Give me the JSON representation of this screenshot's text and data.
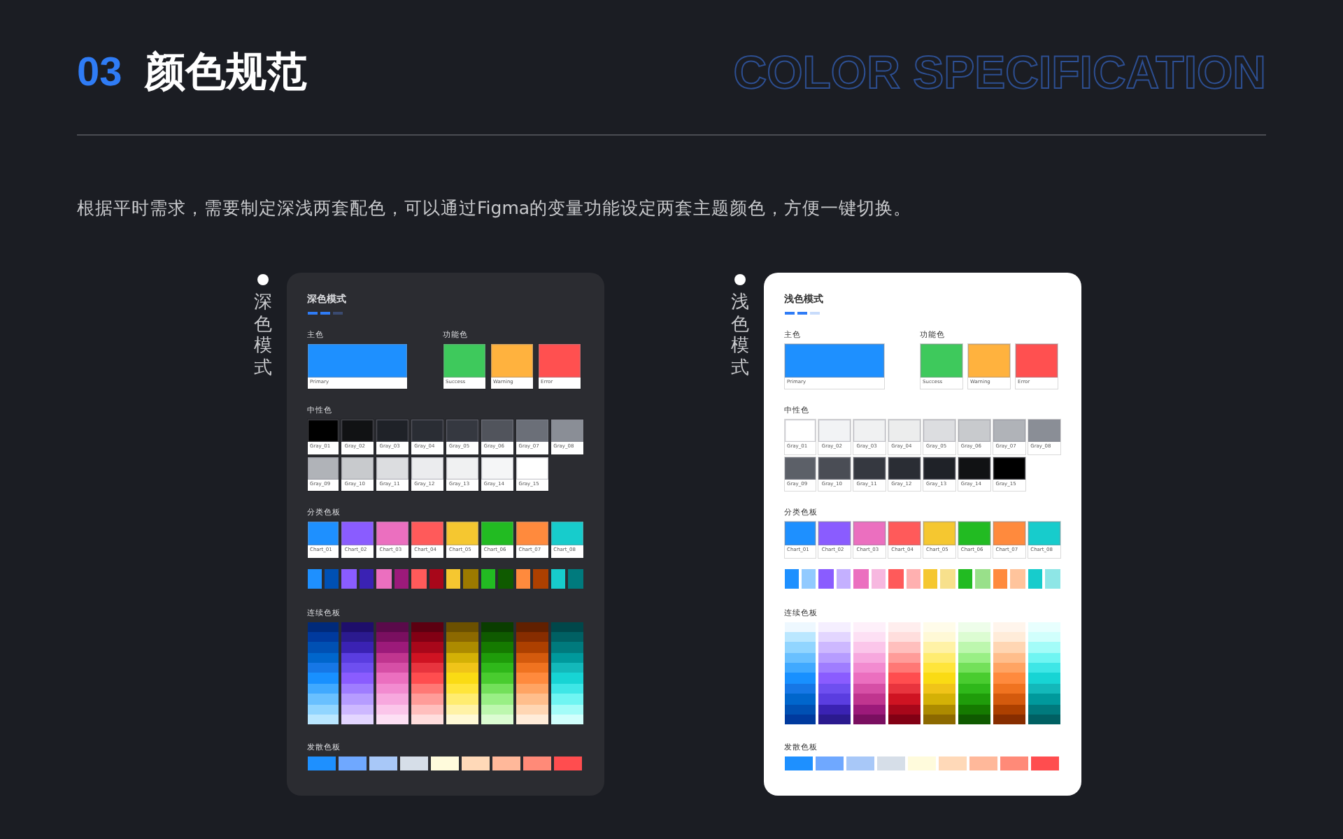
{
  "header": {
    "number": "03",
    "title": "颜色规范",
    "subtitle": "COLOR SPECIFICATION"
  },
  "description": "根据平时需求，需要制定深浅两套配色，可以通过Figma的变量功能设定两套主题颜色，方便一键切换。",
  "panels": [
    {
      "label": "深色模式",
      "kind": "dark",
      "card": {
        "title": "深色模式",
        "primary": {
          "heading": "主色",
          "swatches": [
            {
              "name": "Primary",
              "color": "#1e90ff"
            }
          ]
        },
        "functional": {
          "heading": "功能色",
          "swatches": [
            {
              "name": "Success",
              "color": "#3ec95c"
            },
            {
              "name": "Warning",
              "color": "#ffb23e"
            },
            {
              "name": "Error",
              "color": "#ff5050"
            }
          ]
        },
        "neutral": {
          "heading": "中性色",
          "swatches": [
            {
              "name": "Gray_01",
              "color": "#000000"
            },
            {
              "name": "Gray_02",
              "color": "#111214"
            },
            {
              "name": "Gray_03",
              "color": "#1f2228"
            },
            {
              "name": "Gray_04",
              "color": "#2a2d34"
            },
            {
              "name": "Gray_05",
              "color": "#353840"
            },
            {
              "name": "Gray_06",
              "color": "#51545c"
            },
            {
              "name": "Gray_07",
              "color": "#6b6f78"
            },
            {
              "name": "Gray_08",
              "color": "#8a8e96"
            },
            {
              "name": "Gray_09",
              "color": "#b0b3b8"
            },
            {
              "name": "Gray_10",
              "color": "#c8cacd"
            },
            {
              "name": "Gray_11",
              "color": "#dcdde0"
            },
            {
              "name": "Gray_12",
              "color": "#ebecee"
            },
            {
              "name": "Gray_13",
              "color": "#f0f1f2"
            },
            {
              "name": "Gray_14",
              "color": "#f5f6f7"
            },
            {
              "name": "Gray_15",
              "color": "#ffffff"
            }
          ]
        },
        "categorical": {
          "heading": "分类色板",
          "swatches": [
            {
              "name": "Chart_01",
              "color": "#1e90ff"
            },
            {
              "name": "Chart_02",
              "color": "#8a5cff"
            },
            {
              "name": "Chart_03",
              "color": "#eb6fbf"
            },
            {
              "name": "Chart_04",
              "color": "#ff5a5a"
            },
            {
              "name": "Chart_05",
              "color": "#f5c730"
            },
            {
              "name": "Chart_06",
              "color": "#22bb22"
            },
            {
              "name": "Chart_07",
              "color": "#ff8a3d"
            },
            {
              "name": "Chart_08",
              "color": "#17cccc"
            }
          ],
          "pairs": [
            {
              "color": "#1e90ff"
            },
            {
              "color": "#0050b3"
            },
            {
              "color": "#8a5cff"
            },
            {
              "color": "#3a22b3"
            },
            {
              "color": "#eb6fbf"
            },
            {
              "color": "#9c1a7a"
            },
            {
              "color": "#ff5a5a"
            },
            {
              "color": "#a8071a"
            },
            {
              "color": "#f5c730"
            },
            {
              "color": "#9c7a00"
            },
            {
              "color": "#22bb22"
            },
            {
              "color": "#0f5a00"
            },
            {
              "color": "#ff8a3d"
            },
            {
              "color": "#ad4000"
            },
            {
              "color": "#17cccc"
            },
            {
              "color": "#007a7d"
            }
          ]
        },
        "sequential": {
          "heading": "连续色板",
          "columns": [
            {
              "cells": [
                {
                  "color": "#002a7a"
                },
                {
                  "color": "#003a9e"
                },
                {
                  "color": "#0050b3"
                },
                {
                  "color": "#0066cc"
                },
                {
                  "color": "#1677e6"
                },
                {
                  "color": "#1890ff"
                },
                {
                  "color": "#40a9ff"
                },
                {
                  "color": "#69c0ff"
                },
                {
                  "color": "#91d5ff"
                },
                {
                  "color": "#bae7ff"
                }
              ]
            },
            {
              "cells": [
                {
                  "color": "#1e0e6b"
                },
                {
                  "color": "#2b1a8f"
                },
                {
                  "color": "#3a22b3"
                },
                {
                  "color": "#5a3de0"
                },
                {
                  "color": "#6e4ff0"
                },
                {
                  "color": "#8a5cff"
                },
                {
                  "color": "#9f7dff"
                },
                {
                  "color": "#b69cff"
                },
                {
                  "color": "#cdb8ff"
                },
                {
                  "color": "#e3d6ff"
                }
              ]
            },
            {
              "cells": [
                {
                  "color": "#5a0a4a"
                },
                {
                  "color": "#7a0f60"
                },
                {
                  "color": "#9c1a7a"
                },
                {
                  "color": "#c0358f"
                },
                {
                  "color": "#d64fa6"
                },
                {
                  "color": "#eb6fbf"
                },
                {
                  "color": "#f28bd0"
                },
                {
                  "color": "#f7a8de"
                },
                {
                  "color": "#fbc6ea"
                },
                {
                  "color": "#fde0f4"
                }
              ]
            },
            {
              "cells": [
                {
                  "color": "#5c0011"
                },
                {
                  "color": "#820014"
                },
                {
                  "color": "#a8071a"
                },
                {
                  "color": "#cf1322"
                },
                {
                  "color": "#e8343e"
                },
                {
                  "color": "#ff4d4f"
                },
                {
                  "color": "#ff7875"
                },
                {
                  "color": "#ff9c99"
                },
                {
                  "color": "#ffbfbd"
                },
                {
                  "color": "#ffdedd"
                }
              ]
            },
            {
              "cells": [
                {
                  "color": "#6b5000"
                },
                {
                  "color": "#8c6900"
                },
                {
                  "color": "#ad8b00"
                },
                {
                  "color": "#d4b106"
                },
                {
                  "color": "#f0c419"
                },
                {
                  "color": "#fadb14"
                },
                {
                  "color": "#ffe53b"
                },
                {
                  "color": "#ffec70"
                },
                {
                  "color": "#fff2a6"
                },
                {
                  "color": "#fff9d6"
                }
              ]
            },
            {
              "cells": [
                {
                  "color": "#0a3d00"
                },
                {
                  "color": "#0f5a00"
                },
                {
                  "color": "#157a00"
                },
                {
                  "color": "#1f9c0a"
                },
                {
                  "color": "#2fb81a"
                },
                {
                  "color": "#49cc2f"
                },
                {
                  "color": "#73e05a"
                },
                {
                  "color": "#99ef85"
                },
                {
                  "color": "#bdf7ae"
                },
                {
                  "color": "#dcfcd2"
                }
              ]
            },
            {
              "cells": [
                {
                  "color": "#612000"
                },
                {
                  "color": "#872d00"
                },
                {
                  "color": "#ad4000"
                },
                {
                  "color": "#d45a0d"
                },
                {
                  "color": "#f07320"
                },
                {
                  "color": "#ff8a3d"
                },
                {
                  "color": "#ffa463"
                },
                {
                  "color": "#ffbe8c"
                },
                {
                  "color": "#ffd6b3"
                },
                {
                  "color": "#ffecd9"
                }
              ]
            },
            {
              "cells": [
                {
                  "color": "#00474a"
                },
                {
                  "color": "#006063"
                },
                {
                  "color": "#007a7d"
                },
                {
                  "color": "#00999c"
                },
                {
                  "color": "#13b8ba"
                },
                {
                  "color": "#17d4d4"
                },
                {
                  "color": "#3ee6e6"
                },
                {
                  "color": "#6ff5f2"
                },
                {
                  "color": "#a3fcf8"
                },
                {
                  "color": "#d1fffc"
                }
              ]
            }
          ]
        },
        "diverging": {
          "heading": "发散色板",
          "swatches": [
            {
              "color": "#1e90ff"
            },
            {
              "color": "#6fa8ff"
            },
            {
              "color": "#a8c8f8"
            },
            {
              "color": "#d6dee8"
            },
            {
              "color": "#fffbdc"
            },
            {
              "color": "#ffd9b8"
            },
            {
              "color": "#ffb89a"
            },
            {
              "color": "#ff8a78"
            },
            {
              "color": "#ff4d4f"
            }
          ]
        }
      }
    },
    {
      "label": "浅色模式",
      "kind": "light",
      "card": {
        "title": "浅色模式",
        "primary": {
          "heading": "主色",
          "swatches": [
            {
              "name": "Primary",
              "color": "#1e90ff"
            }
          ]
        },
        "functional": {
          "heading": "功能色",
          "swatches": [
            {
              "name": "Success",
              "color": "#3ec95c"
            },
            {
              "name": "Warning",
              "color": "#ffb23e"
            },
            {
              "name": "Error",
              "color": "#ff5050"
            }
          ]
        },
        "neutral": {
          "heading": "中性色",
          "swatches": [
            {
              "name": "Gray_01",
              "color": "#ffffff"
            },
            {
              "name": "Gray_02",
              "color": "#f2f3f5"
            },
            {
              "name": "Gray_03",
              "color": "#f0f1f2"
            },
            {
              "name": "Gray_04",
              "color": "#eceded"
            },
            {
              "name": "Gray_05",
              "color": "#dcdde0"
            },
            {
              "name": "Gray_06",
              "color": "#c8cacd"
            },
            {
              "name": "Gray_07",
              "color": "#b0b3b8"
            },
            {
              "name": "Gray_08",
              "color": "#8a8e96"
            },
            {
              "name": "Gray_09",
              "color": "#5c6068"
            },
            {
              "name": "Gray_10",
              "color": "#4a4d55"
            },
            {
              "name": "Gray_11",
              "color": "#353840"
            },
            {
              "name": "Gray_12",
              "color": "#2a2d34"
            },
            {
              "name": "Gray_13",
              "color": "#1f2228"
            },
            {
              "name": "Gray_14",
              "color": "#111214"
            },
            {
              "name": "Gray_15",
              "color": "#000000"
            }
          ]
        },
        "categorical": {
          "heading": "分类色板",
          "swatches": [
            {
              "name": "Chart_01",
              "color": "#1e90ff"
            },
            {
              "name": "Chart_02",
              "color": "#8a5cff"
            },
            {
              "name": "Chart_03",
              "color": "#eb6fbf"
            },
            {
              "name": "Chart_04",
              "color": "#ff5a5a"
            },
            {
              "name": "Chart_05",
              "color": "#f5c730"
            },
            {
              "name": "Chart_06",
              "color": "#22bb22"
            },
            {
              "name": "Chart_07",
              "color": "#ff8a3d"
            },
            {
              "name": "Chart_08",
              "color": "#17cccc"
            }
          ],
          "pairs": [
            {
              "color": "#1e90ff"
            },
            {
              "color": "#91caff"
            },
            {
              "color": "#8a5cff"
            },
            {
              "color": "#c4b0ff"
            },
            {
              "color": "#eb6fbf"
            },
            {
              "color": "#f7b8e0"
            },
            {
              "color": "#ff5a5a"
            },
            {
              "color": "#ffb0b0"
            },
            {
              "color": "#f5c730"
            },
            {
              "color": "#f7e08c"
            },
            {
              "color": "#22bb22"
            },
            {
              "color": "#99e08a"
            },
            {
              "color": "#ff8a3d"
            },
            {
              "color": "#ffc49c"
            },
            {
              "color": "#17cccc"
            },
            {
              "color": "#8ee6e6"
            }
          ]
        },
        "sequential": {
          "heading": "连续色板",
          "columns": [
            {
              "cells": [
                {
                  "color": "#eef8ff"
                },
                {
                  "color": "#bae7ff"
                },
                {
                  "color": "#91d5ff"
                },
                {
                  "color": "#69c0ff"
                },
                {
                  "color": "#40a9ff"
                },
                {
                  "color": "#1890ff"
                },
                {
                  "color": "#1677e6"
                },
                {
                  "color": "#0066cc"
                },
                {
                  "color": "#0050b3"
                },
                {
                  "color": "#003a9e"
                }
              ]
            },
            {
              "cells": [
                {
                  "color": "#f5efff"
                },
                {
                  "color": "#e3d6ff"
                },
                {
                  "color": "#cdb8ff"
                },
                {
                  "color": "#b69cff"
                },
                {
                  "color": "#9f7dff"
                },
                {
                  "color": "#8a5cff"
                },
                {
                  "color": "#6e4ff0"
                },
                {
                  "color": "#5a3de0"
                },
                {
                  "color": "#3a22b3"
                },
                {
                  "color": "#2b1a8f"
                }
              ]
            },
            {
              "cells": [
                {
                  "color": "#fef0fa"
                },
                {
                  "color": "#fde0f4"
                },
                {
                  "color": "#fbc6ea"
                },
                {
                  "color": "#f7a8de"
                },
                {
                  "color": "#f28bd0"
                },
                {
                  "color": "#eb6fbf"
                },
                {
                  "color": "#d64fa6"
                },
                {
                  "color": "#c0358f"
                },
                {
                  "color": "#9c1a7a"
                },
                {
                  "color": "#7a0f60"
                }
              ]
            },
            {
              "cells": [
                {
                  "color": "#ffeeee"
                },
                {
                  "color": "#ffdedd"
                },
                {
                  "color": "#ffbfbd"
                },
                {
                  "color": "#ff9c99"
                },
                {
                  "color": "#ff7875"
                },
                {
                  "color": "#ff4d4f"
                },
                {
                  "color": "#e8343e"
                },
                {
                  "color": "#cf1322"
                },
                {
                  "color": "#a8071a"
                },
                {
                  "color": "#820014"
                }
              ]
            },
            {
              "cells": [
                {
                  "color": "#fffcea"
                },
                {
                  "color": "#fff9d6"
                },
                {
                  "color": "#fff2a6"
                },
                {
                  "color": "#ffec70"
                },
                {
                  "color": "#ffe53b"
                },
                {
                  "color": "#fadb14"
                },
                {
                  "color": "#f0c419"
                },
                {
                  "color": "#d4b106"
                },
                {
                  "color": "#ad8b00"
                },
                {
                  "color": "#8c6900"
                }
              ]
            },
            {
              "cells": [
                {
                  "color": "#eefdea"
                },
                {
                  "color": "#dcfcd2"
                },
                {
                  "color": "#bdf7ae"
                },
                {
                  "color": "#99ef85"
                },
                {
                  "color": "#73e05a"
                },
                {
                  "color": "#49cc2f"
                },
                {
                  "color": "#2fb81a"
                },
                {
                  "color": "#1f9c0a"
                },
                {
                  "color": "#157a00"
                },
                {
                  "color": "#0f5a00"
                }
              ]
            },
            {
              "cells": [
                {
                  "color": "#fff5ec"
                },
                {
                  "color": "#ffecd9"
                },
                {
                  "color": "#ffd6b3"
                },
                {
                  "color": "#ffbe8c"
                },
                {
                  "color": "#ffa463"
                },
                {
                  "color": "#ff8a3d"
                },
                {
                  "color": "#f07320"
                },
                {
                  "color": "#d45a0d"
                },
                {
                  "color": "#ad4000"
                },
                {
                  "color": "#872d00"
                }
              ]
            },
            {
              "cells": [
                {
                  "color": "#e8fffe"
                },
                {
                  "color": "#d1fffc"
                },
                {
                  "color": "#a3fcf8"
                },
                {
                  "color": "#6ff5f2"
                },
                {
                  "color": "#3ee6e6"
                },
                {
                  "color": "#17d4d4"
                },
                {
                  "color": "#13b8ba"
                },
                {
                  "color": "#00999c"
                },
                {
                  "color": "#007a7d"
                },
                {
                  "color": "#006063"
                }
              ]
            }
          ]
        },
        "diverging": {
          "heading": "发散色板",
          "swatches": [
            {
              "color": "#1e90ff"
            },
            {
              "color": "#6fa8ff"
            },
            {
              "color": "#a8c8f8"
            },
            {
              "color": "#d6dee8"
            },
            {
              "color": "#fffbdc"
            },
            {
              "color": "#ffd9b8"
            },
            {
              "color": "#ffb89a"
            },
            {
              "color": "#ff8a78"
            },
            {
              "color": "#ff4d4f"
            }
          ]
        }
      }
    }
  ]
}
